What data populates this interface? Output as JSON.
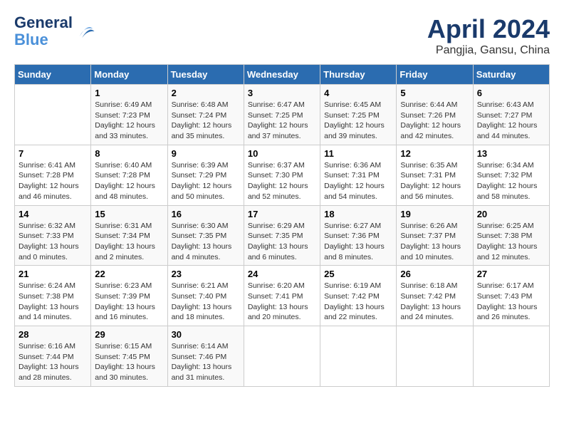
{
  "header": {
    "logo_line1": "General",
    "logo_line2": "Blue",
    "main_title": "April 2024",
    "sub_title": "Pangjia, Gansu, China"
  },
  "days_of_week": [
    "Sunday",
    "Monday",
    "Tuesday",
    "Wednesday",
    "Thursday",
    "Friday",
    "Saturday"
  ],
  "weeks": [
    [
      {
        "day": "",
        "info": ""
      },
      {
        "day": "1",
        "info": "Sunrise: 6:49 AM\nSunset: 7:23 PM\nDaylight: 12 hours\nand 33 minutes."
      },
      {
        "day": "2",
        "info": "Sunrise: 6:48 AM\nSunset: 7:24 PM\nDaylight: 12 hours\nand 35 minutes."
      },
      {
        "day": "3",
        "info": "Sunrise: 6:47 AM\nSunset: 7:25 PM\nDaylight: 12 hours\nand 37 minutes."
      },
      {
        "day": "4",
        "info": "Sunrise: 6:45 AM\nSunset: 7:25 PM\nDaylight: 12 hours\nand 39 minutes."
      },
      {
        "day": "5",
        "info": "Sunrise: 6:44 AM\nSunset: 7:26 PM\nDaylight: 12 hours\nand 42 minutes."
      },
      {
        "day": "6",
        "info": "Sunrise: 6:43 AM\nSunset: 7:27 PM\nDaylight: 12 hours\nand 44 minutes."
      }
    ],
    [
      {
        "day": "7",
        "info": "Sunrise: 6:41 AM\nSunset: 7:28 PM\nDaylight: 12 hours\nand 46 minutes."
      },
      {
        "day": "8",
        "info": "Sunrise: 6:40 AM\nSunset: 7:28 PM\nDaylight: 12 hours\nand 48 minutes."
      },
      {
        "day": "9",
        "info": "Sunrise: 6:39 AM\nSunset: 7:29 PM\nDaylight: 12 hours\nand 50 minutes."
      },
      {
        "day": "10",
        "info": "Sunrise: 6:37 AM\nSunset: 7:30 PM\nDaylight: 12 hours\nand 52 minutes."
      },
      {
        "day": "11",
        "info": "Sunrise: 6:36 AM\nSunset: 7:31 PM\nDaylight: 12 hours\nand 54 minutes."
      },
      {
        "day": "12",
        "info": "Sunrise: 6:35 AM\nSunset: 7:31 PM\nDaylight: 12 hours\nand 56 minutes."
      },
      {
        "day": "13",
        "info": "Sunrise: 6:34 AM\nSunset: 7:32 PM\nDaylight: 12 hours\nand 58 minutes."
      }
    ],
    [
      {
        "day": "14",
        "info": "Sunrise: 6:32 AM\nSunset: 7:33 PM\nDaylight: 13 hours\nand 0 minutes."
      },
      {
        "day": "15",
        "info": "Sunrise: 6:31 AM\nSunset: 7:34 PM\nDaylight: 13 hours\nand 2 minutes."
      },
      {
        "day": "16",
        "info": "Sunrise: 6:30 AM\nSunset: 7:35 PM\nDaylight: 13 hours\nand 4 minutes."
      },
      {
        "day": "17",
        "info": "Sunrise: 6:29 AM\nSunset: 7:35 PM\nDaylight: 13 hours\nand 6 minutes."
      },
      {
        "day": "18",
        "info": "Sunrise: 6:27 AM\nSunset: 7:36 PM\nDaylight: 13 hours\nand 8 minutes."
      },
      {
        "day": "19",
        "info": "Sunrise: 6:26 AM\nSunset: 7:37 PM\nDaylight: 13 hours\nand 10 minutes."
      },
      {
        "day": "20",
        "info": "Sunrise: 6:25 AM\nSunset: 7:38 PM\nDaylight: 13 hours\nand 12 minutes."
      }
    ],
    [
      {
        "day": "21",
        "info": "Sunrise: 6:24 AM\nSunset: 7:38 PM\nDaylight: 13 hours\nand 14 minutes."
      },
      {
        "day": "22",
        "info": "Sunrise: 6:23 AM\nSunset: 7:39 PM\nDaylight: 13 hours\nand 16 minutes."
      },
      {
        "day": "23",
        "info": "Sunrise: 6:21 AM\nSunset: 7:40 PM\nDaylight: 13 hours\nand 18 minutes."
      },
      {
        "day": "24",
        "info": "Sunrise: 6:20 AM\nSunset: 7:41 PM\nDaylight: 13 hours\nand 20 minutes."
      },
      {
        "day": "25",
        "info": "Sunrise: 6:19 AM\nSunset: 7:42 PM\nDaylight: 13 hours\nand 22 minutes."
      },
      {
        "day": "26",
        "info": "Sunrise: 6:18 AM\nSunset: 7:42 PM\nDaylight: 13 hours\nand 24 minutes."
      },
      {
        "day": "27",
        "info": "Sunrise: 6:17 AM\nSunset: 7:43 PM\nDaylight: 13 hours\nand 26 minutes."
      }
    ],
    [
      {
        "day": "28",
        "info": "Sunrise: 6:16 AM\nSunset: 7:44 PM\nDaylight: 13 hours\nand 28 minutes."
      },
      {
        "day": "29",
        "info": "Sunrise: 6:15 AM\nSunset: 7:45 PM\nDaylight: 13 hours\nand 30 minutes."
      },
      {
        "day": "30",
        "info": "Sunrise: 6:14 AM\nSunset: 7:46 PM\nDaylight: 13 hours\nand 31 minutes."
      },
      {
        "day": "",
        "info": ""
      },
      {
        "day": "",
        "info": ""
      },
      {
        "day": "",
        "info": ""
      },
      {
        "day": "",
        "info": ""
      }
    ]
  ]
}
